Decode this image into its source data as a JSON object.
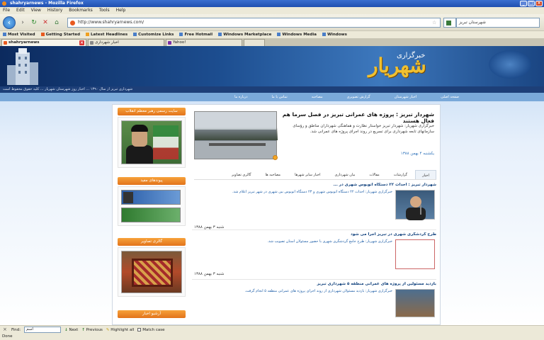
{
  "window": {
    "title": "shahryarnews - Mozilla Firefox",
    "menus": [
      "File",
      "Edit",
      "View",
      "History",
      "Bookmarks",
      "Tools",
      "Help"
    ]
  },
  "navbar": {
    "url": "http://www.shahryarnews.com/",
    "search_text": "شهرستان تبریز"
  },
  "bookmarks": [
    "Most Visited",
    "Getting Started",
    "Latest Headlines",
    "Customize Links",
    "Free Hotmail",
    "Windows Marketplace",
    "Windows Media",
    "Windows"
  ],
  "tabs": [
    {
      "label": "shahryarnews",
      "active": true
    },
    {
      "label": "اخبار شهرداری",
      "active": false
    },
    {
      "label": "Yahoo!",
      "active": false
    },
    {
      "label": "",
      "active": false
    }
  ],
  "site": {
    "logo": "شهریار",
    "logo_sub": "خبرگزاری",
    "ticker": "شهرداری تبریز از سال ۱۳۹۰ ... اخبار روز شهرستان شهریار ... کلیه حقوق محفوظ است",
    "topnav": [
      "صفحه اصلی",
      "اخبار شهرستان",
      "گزارش تصویری",
      "مصاحبه",
      "تماس با ما",
      "درباره ما"
    ]
  },
  "sidebar": {
    "box1_title": "سایت رسمی رهبر معظم انقلاب",
    "box2_title": "پیوندهای مفید",
    "box2_links": [
      "",
      ""
    ],
    "box3_title": "گالری تصاویر",
    "box4_title": "آرشیو اخبار"
  },
  "feature": {
    "title": "شهردار تبریز : پروژه های عمرانی تبریز در فصل سرما هم فعال هستند",
    "text": "خبرگزاری شهریار: شهردار تبریز خواستار نظارت و هماهنگی شهرداران مناطق و رؤسای سازمانهای تابعه شهرداری برای تسریع در روند اجرای پروژه های عمرانی شد.",
    "date": "یکشنبه ۴ بهمن ۱۳۸۸"
  },
  "tab_strip": [
    "اخبار",
    "گزارشات",
    "مقالات",
    "بیان شهرداری",
    "اخبار سایر شهرها",
    "مصاحبه ها",
    "گالری تصاویر"
  ],
  "news": [
    {
      "title": "شهردار تبریز : احداث ۲۲ دستگاه اتوبوس شهری در ...",
      "summary": "خبرگزاری شهریار: احداث ۲۲ دستگاه اتوبوس شهری و ۲۳ دستگاه اتوبوس بین شهری در شهر تبریز اعلام شد.",
      "date": "شنبه ۳ بهمن ۱۳۸۸"
    },
    {
      "title": "طرح گردشگری شهری در تبریز اجرا می شود",
      "summary": "خبرگزاری شهریار: طرح جامع گردشگری شهری با حضور مسئولان استان تصویب شد.",
      "date": "شنبه ۳ بهمن ۱۳۸۸"
    },
    {
      "title": "بازدید مسئولین از پروژه های عمرانی منطقه ۵ شهرداری تبریز",
      "summary": "خبرگزاری شهریار: بازدید مسئولان شهرداری از روند اجرای پروژه های عمرانی منطقه ۵ انجام گرفت.",
      "date": ""
    }
  ],
  "findbar": {
    "label": "Find:",
    "value": "اسم",
    "next": "Next",
    "previous": "Previous",
    "highlight": "Highlight all",
    "match_case": "Match case"
  },
  "status": "Done"
}
